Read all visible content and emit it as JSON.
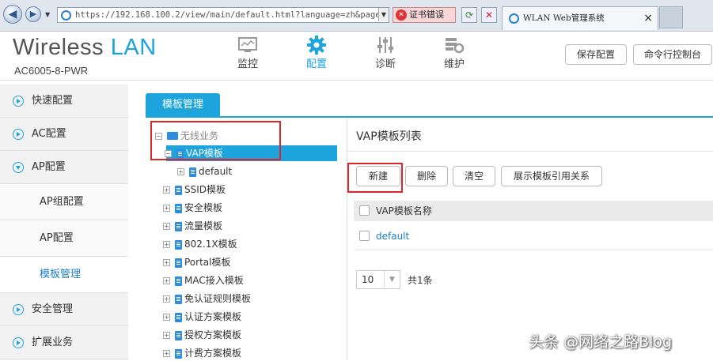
{
  "browser": {
    "url": "https://192.168.100.2/view/main/default.html?language=zh&page",
    "cert_error": "证书错误",
    "tab_title": "WLAN Web管理系统",
    "tab_close": "×"
  },
  "header": {
    "logo_part1": "Wireless",
    "logo_part2": "LAN",
    "model": "AC6005-8-PWR",
    "nav": [
      {
        "label": "监控",
        "icon": "monitor-icon"
      },
      {
        "label": "配置",
        "icon": "gear-icon"
      },
      {
        "label": "诊断",
        "icon": "sliders-icon"
      },
      {
        "label": "维护",
        "icon": "maintenance-icon"
      }
    ],
    "save_config": "保存配置",
    "cli_console": "命令行控制台"
  },
  "sidebar": {
    "items": [
      {
        "label": "快速配置"
      },
      {
        "label": "AC配置"
      },
      {
        "label": "AP配置"
      },
      {
        "label": "AP组配置"
      },
      {
        "label": "AP配置"
      },
      {
        "label": "模板管理"
      },
      {
        "label": "安全管理"
      },
      {
        "label": "扩展业务"
      }
    ]
  },
  "main_tab": "模板管理",
  "tree": {
    "root": "无线业务",
    "nodes": [
      {
        "label": "VAP模板"
      },
      {
        "label": "default"
      },
      {
        "label": "SSID模板"
      },
      {
        "label": "安全模板"
      },
      {
        "label": "流量模板"
      },
      {
        "label": "802.1X模板"
      },
      {
        "label": "Portal模板"
      },
      {
        "label": "MAC接入模板"
      },
      {
        "label": "免认证规则模板"
      },
      {
        "label": "认证方案模板"
      },
      {
        "label": "授权方案模板"
      },
      {
        "label": "计费方案模板"
      }
    ]
  },
  "panel": {
    "title": "VAP模板列表",
    "buttons": {
      "new": "新建",
      "delete": "删除",
      "clear": "清空",
      "show_ref": "展示模板引用关系"
    },
    "column": "VAP模板名称",
    "rows": [
      {
        "name": "default"
      }
    ],
    "page_size": "10",
    "total": "共1条"
  },
  "watermark": "头条 @网络之路Blog",
  "colors": {
    "accent": "#1da4dd",
    "annotation": "#e0242b"
  }
}
